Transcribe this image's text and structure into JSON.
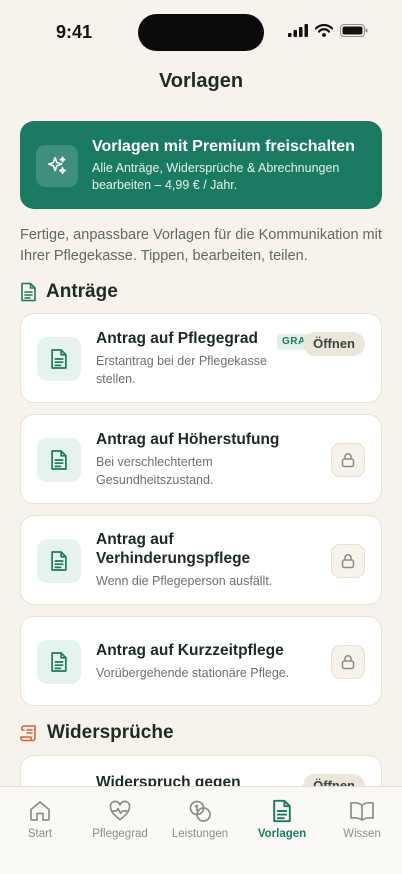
{
  "status_bar": {
    "time": "9:41"
  },
  "header": {
    "title": "Vorlagen"
  },
  "premium": {
    "title": "Vorlagen mit Premium freischalten",
    "subtitle": "Alle Anträge, Widersprüche & Abrechnungen bearbeiten – 4,99 € / Jahr.",
    "icon": "sparkles-icon"
  },
  "intro": "Fertige, anpassbare Vorlagen für die Kommunikation mit Ihrer Pflegekasse. Tippen, bearbeiten, teilen.",
  "sections": [
    {
      "title": "Anträge",
      "icon": "document-icon",
      "items": [
        {
          "title": "Antrag auf Pflegegrad",
          "desc": "Erstantrag bei der Pflegekasse stellen.",
          "badge": "GRATIS",
          "action": "Öffnen"
        },
        {
          "title": "Antrag auf Höherstufung",
          "desc": "Bei verschlechtertem Gesundheitszustand.",
          "action": "locked"
        },
        {
          "title": "Antrag auf Verhinderungspflege",
          "desc": "Wenn die Pflegeperson ausfällt.",
          "action": "locked"
        },
        {
          "title": "Antrag auf Kurzzeitpflege",
          "desc": "Vorübergehende stationäre Pflege.",
          "action": "locked"
        }
      ]
    },
    {
      "title": "Widersprüche",
      "icon": "scroll-icon",
      "items": [
        {
          "title": "Widerspruch gegen",
          "action": "Öffnen"
        }
      ]
    }
  ],
  "tabs": [
    {
      "label": "Start",
      "icon": "home-icon",
      "active": false
    },
    {
      "label": "Pflegegrad",
      "icon": "heart-pulse-icon",
      "active": false
    },
    {
      "label": "Leistungen",
      "icon": "coins-icon",
      "active": false
    },
    {
      "label": "Vorlagen",
      "icon": "document-icon",
      "active": true
    },
    {
      "label": "Wissen",
      "icon": "book-icon",
      "active": false
    }
  ],
  "colors": {
    "accent": "#1a7a62",
    "background": "#f7f3ec",
    "card": "#ffffff",
    "muted": "#8a8f8a"
  }
}
